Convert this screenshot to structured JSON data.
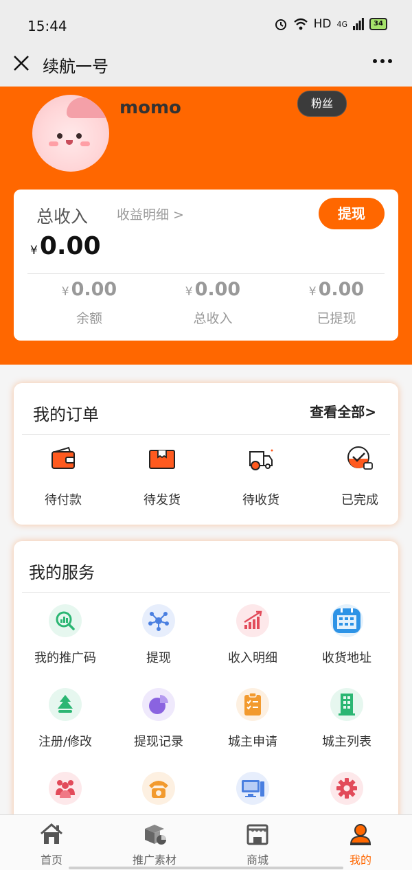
{
  "status_bar": {
    "time": "15:44",
    "network": "HD",
    "signal": "4G",
    "battery": "34"
  },
  "nav": {
    "title": "续航一号"
  },
  "profile": {
    "username": "momo",
    "fans_label": "粉丝"
  },
  "income": {
    "title": "总收入",
    "detail_link": "收益明细 >",
    "withdraw_label": "提现",
    "currency": "¥",
    "total": "0.00",
    "stats": [
      {
        "value": "0.00",
        "label": "余额"
      },
      {
        "value": "0.00",
        "label": "总收入"
      },
      {
        "value": "0.00",
        "label": "已提现"
      }
    ]
  },
  "orders": {
    "title": "我的订单",
    "view_all": "查看全部>",
    "items": [
      {
        "label": "待付款",
        "icon": "wallet-icon"
      },
      {
        "label": "待发货",
        "icon": "package-icon"
      },
      {
        "label": "待收货",
        "icon": "delivery-truck-icon"
      },
      {
        "label": "已完成",
        "icon": "completed-check-icon"
      }
    ]
  },
  "services": {
    "title": "我的服务",
    "items": [
      {
        "label": "我的推广码",
        "icon": "promo-code-icon",
        "color": "#2bb673",
        "bg": "#e6f7ef"
      },
      {
        "label": "提现",
        "icon": "network-icon",
        "color": "#4a7fe0",
        "bg": "#e7eefc"
      },
      {
        "label": "收入明细",
        "icon": "growth-chart-icon",
        "color": "#e24b5a",
        "bg": "#fde8ea"
      },
      {
        "label": "收货地址",
        "icon": "calendar-icon",
        "color": "#2d93e6",
        "bg": "#e3f1fc"
      },
      {
        "label": "注册/修改",
        "icon": "tree-icon",
        "color": "#2bb673",
        "bg": "#e6f7ef"
      },
      {
        "label": "提现记录",
        "icon": "pie-chart-icon",
        "color": "#8a63e0",
        "bg": "#efe9fc"
      },
      {
        "label": "城主申请",
        "icon": "clipboard-icon",
        "color": "#f29a2e",
        "bg": "#fdf0e1"
      },
      {
        "label": "城主列表",
        "icon": "building-icon",
        "color": "#2bb673",
        "bg": "#e6f7ef"
      },
      {
        "label": "",
        "icon": "team-icon",
        "color": "#e24b5a",
        "bg": "#fde8ea"
      },
      {
        "label": "",
        "icon": "telephone-icon",
        "color": "#f29a2e",
        "bg": "#fdf0e1"
      },
      {
        "label": "",
        "icon": "computer-icon",
        "color": "#4a7fe0",
        "bg": "#e7eefc"
      },
      {
        "label": "",
        "icon": "settings-gear-icon",
        "color": "#e24b5a",
        "bg": "#fde8ea"
      }
    ]
  },
  "tabbar": {
    "items": [
      {
        "label": "首页",
        "icon": "home-icon"
      },
      {
        "label": "推广素材",
        "icon": "materials-icon"
      },
      {
        "label": "商城",
        "icon": "shop-icon"
      },
      {
        "label": "我的",
        "icon": "profile-icon"
      }
    ],
    "active_index": 3
  },
  "colors": {
    "brand": "#ff6700",
    "badge": "#3b3b3b"
  }
}
